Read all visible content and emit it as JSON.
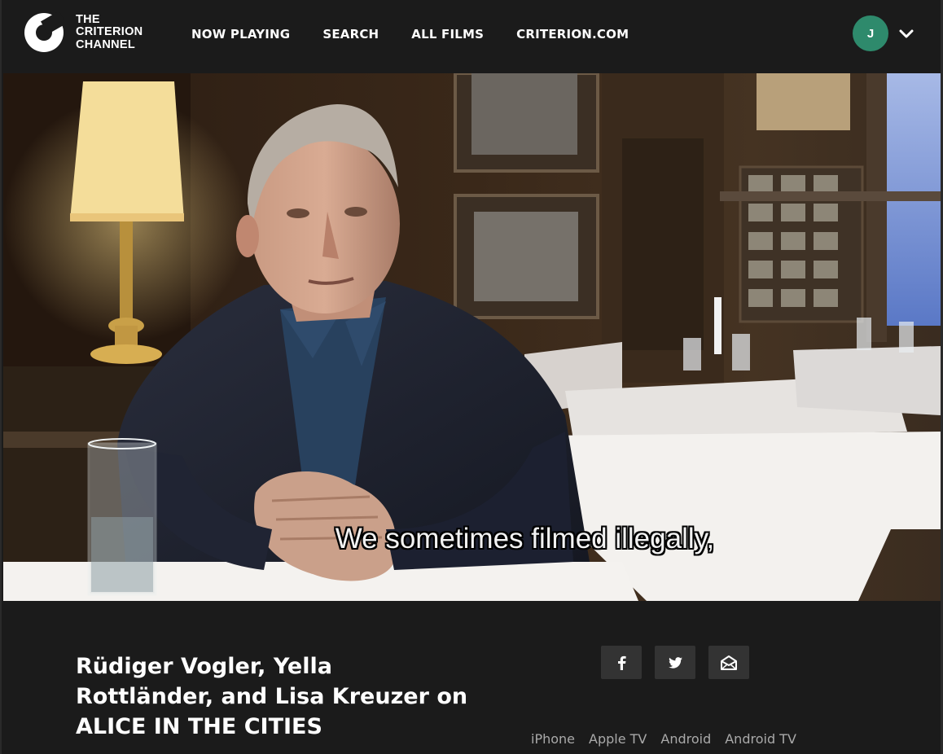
{
  "brand": {
    "line1": "THE",
    "line2": "CRITERION",
    "line3": "CHANNEL"
  },
  "nav": {
    "items": [
      {
        "label": "NOW PLAYING"
      },
      {
        "label": "SEARCH"
      },
      {
        "label": "ALL FILMS"
      },
      {
        "label": "CRITERION.COM"
      }
    ]
  },
  "user": {
    "initial": "J",
    "avatar_color": "#2e8a6c"
  },
  "video": {
    "subtitle": "We sometimes filmed illegally,"
  },
  "feature": {
    "title_lines": [
      "Rüdiger Vogler, Yella",
      "Rottländer, and Lisa Kreuzer on",
      "ALICE IN THE CITIES"
    ]
  },
  "share": {
    "buttons": [
      {
        "icon": "facebook-icon"
      },
      {
        "icon": "twitter-icon"
      },
      {
        "icon": "email-icon"
      }
    ]
  },
  "platforms": {
    "items": [
      "iPhone",
      "Apple TV",
      "Android",
      "Android TV"
    ]
  }
}
